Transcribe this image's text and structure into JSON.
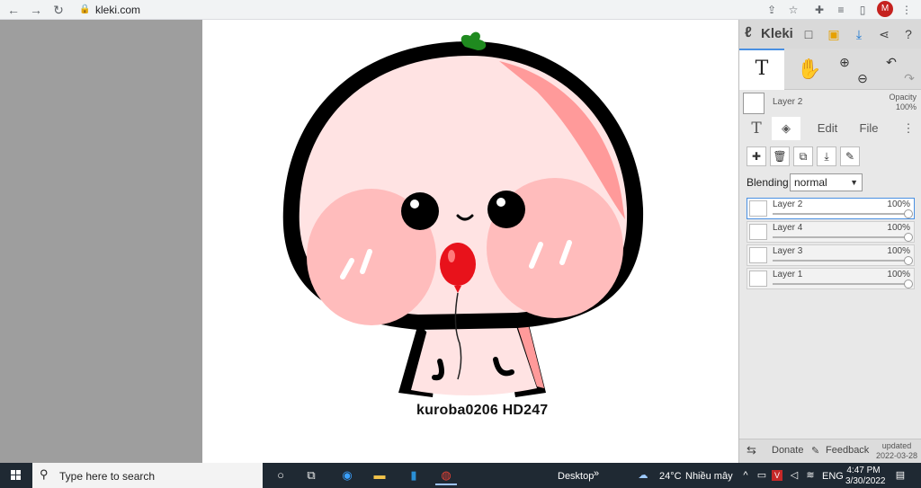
{
  "browser": {
    "url": "kleki.com",
    "profile_initial": "M"
  },
  "canvas": {
    "caption": "kuroba0206 HD247"
  },
  "app": {
    "name": "Kleki"
  },
  "current_layer": {
    "name": "Layer 2",
    "opacity_label": "Opacity",
    "opacity_value": "100%"
  },
  "tabs": {
    "edit": "Edit",
    "file": "File"
  },
  "blending": {
    "label": "Blending",
    "value": "normal"
  },
  "layers": [
    {
      "name": "Layer 2",
      "opacity": "100%",
      "active": true
    },
    {
      "name": "Layer 4",
      "opacity": "100%",
      "active": false
    },
    {
      "name": "Layer 3",
      "opacity": "100%",
      "active": false
    },
    {
      "name": "Layer 1",
      "opacity": "100%",
      "active": false
    }
  ],
  "footer": {
    "donate": "Donate",
    "feedback": "Feedback",
    "updated_label": "updated",
    "updated_date": "2022-03-28"
  },
  "taskbar": {
    "search_placeholder": "Type here to search",
    "desktop_label": "Desktop",
    "weather_temp": "24°C",
    "weather_desc": "Nhiều mây",
    "language": "ENG",
    "time": "4:47 PM",
    "date": "3/30/2022"
  },
  "colors": {
    "accent": "#4a90e2",
    "workspace_bg": "#9e9e9e",
    "taskbar_bg": "#1f2933"
  }
}
